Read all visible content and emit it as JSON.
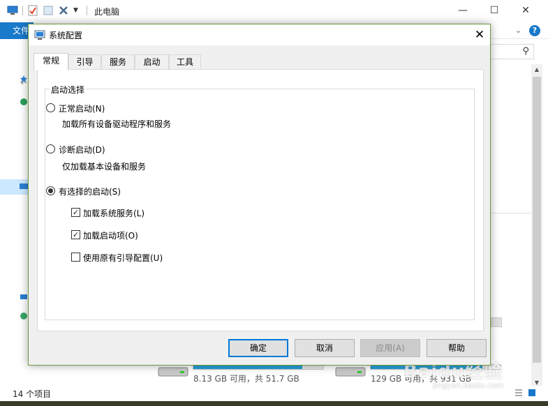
{
  "explorer": {
    "title": "此电脑",
    "file_tab": "文件",
    "help": "?",
    "status_count": "14 个项目",
    "drives": [
      {
        "text": "8.13 GB 可用，共 51.7 GB",
        "fill_fraction": 0.84
      },
      {
        "text": "129 GB 可用，共 931 GB",
        "fill_fraction": 0.86
      }
    ],
    "watermark": "Baidu经验",
    "watermark_sub": "jingyan.baidu.com",
    "win_min": "—",
    "win_max": "☐",
    "win_close": "✕",
    "search_icon": "⚲"
  },
  "dialog": {
    "title": "系统配置",
    "close": "✕",
    "tabs": [
      {
        "label": "常规",
        "active": true
      },
      {
        "label": "引导",
        "active": false
      },
      {
        "label": "服务",
        "active": false
      },
      {
        "label": "启动",
        "active": false
      },
      {
        "label": "工具",
        "active": false
      }
    ],
    "group_label": "启动选择",
    "options": {
      "normal": {
        "label": "正常启动(N)",
        "desc": "加载所有设备驱动程序和服务",
        "selected": false
      },
      "diagnostic": {
        "label": "诊断启动(D)",
        "desc": "仅加载基本设备和服务",
        "selected": false
      },
      "selective": {
        "label": "有选择的启动(S)",
        "selected": true
      }
    },
    "checkboxes": {
      "load_services": {
        "label": "加载系统服务(L)",
        "checked": true
      },
      "load_startup": {
        "label": "加载启动项(O)",
        "checked": true
      },
      "use_original_boot": {
        "label": "使用原有引导配置(U)",
        "checked": false
      }
    },
    "buttons": {
      "ok": "确定",
      "cancel": "取消",
      "apply": "应用(A)",
      "help": "帮助"
    }
  }
}
